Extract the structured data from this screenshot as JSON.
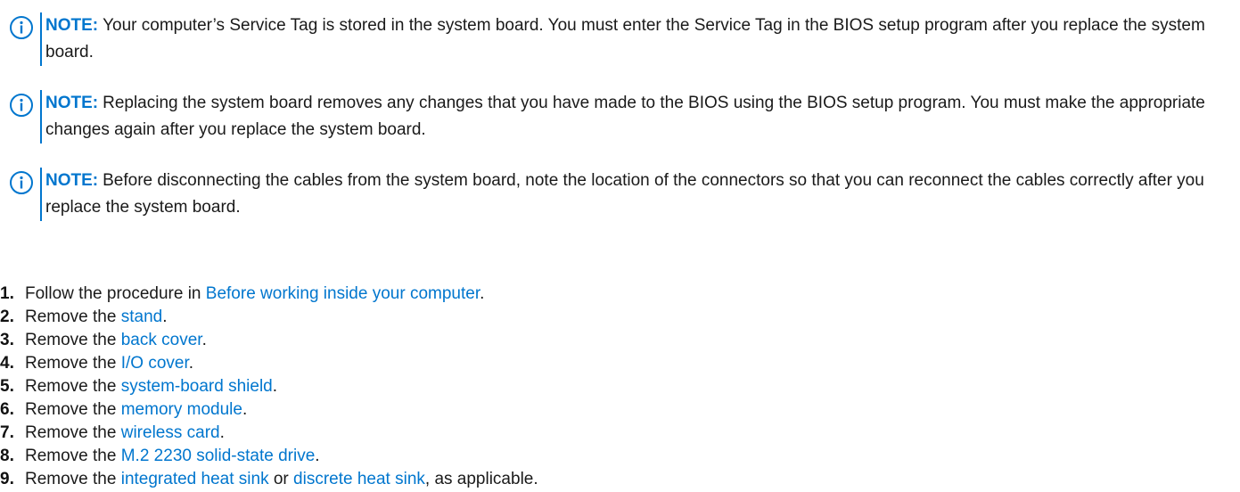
{
  "notes": [
    {
      "label": "NOTE:",
      "text": "Your computer’s Service Tag is stored in the system board. You must enter the Service Tag in the BIOS setup program after you replace the system board."
    },
    {
      "label": "NOTE:",
      "text": "Replacing the system board removes any changes that you have made to the BIOS using the BIOS setup program. You must make the appropriate changes again after you replace the system board."
    },
    {
      "label": "NOTE:",
      "text": "Before disconnecting the cables from the system board, note the location of the connectors so that you can reconnect the cables correctly after you replace the system board."
    }
  ],
  "steps": [
    {
      "num": "1.",
      "prefix": "Follow the procedure in ",
      "link": "Before working inside your computer",
      "suffix": "."
    },
    {
      "num": "2.",
      "prefix": "Remove the ",
      "link": "stand",
      "suffix": "."
    },
    {
      "num": "3.",
      "prefix": "Remove the ",
      "link": "back cover",
      "suffix": "."
    },
    {
      "num": "4.",
      "prefix": "Remove the ",
      "link": "I/O cover",
      "suffix": "."
    },
    {
      "num": "5.",
      "prefix": "Remove the ",
      "link": "system-board shield",
      "suffix": "."
    },
    {
      "num": "6.",
      "prefix": "Remove the ",
      "link": "memory module",
      "suffix": "."
    },
    {
      "num": "7.",
      "prefix": "Remove the ",
      "link": "wireless card",
      "suffix": "."
    },
    {
      "num": "8.",
      "prefix": "Remove the ",
      "link": "M.2 2230 solid-state drive",
      "suffix": "."
    },
    {
      "num": "9.",
      "prefix": "Remove the ",
      "link": "integrated heat sink",
      "middle": " or ",
      "link2": "discrete heat sink",
      "suffix": ", as applicable."
    }
  ],
  "icon_color": "#0076ce",
  "link_color": "#0076ce"
}
